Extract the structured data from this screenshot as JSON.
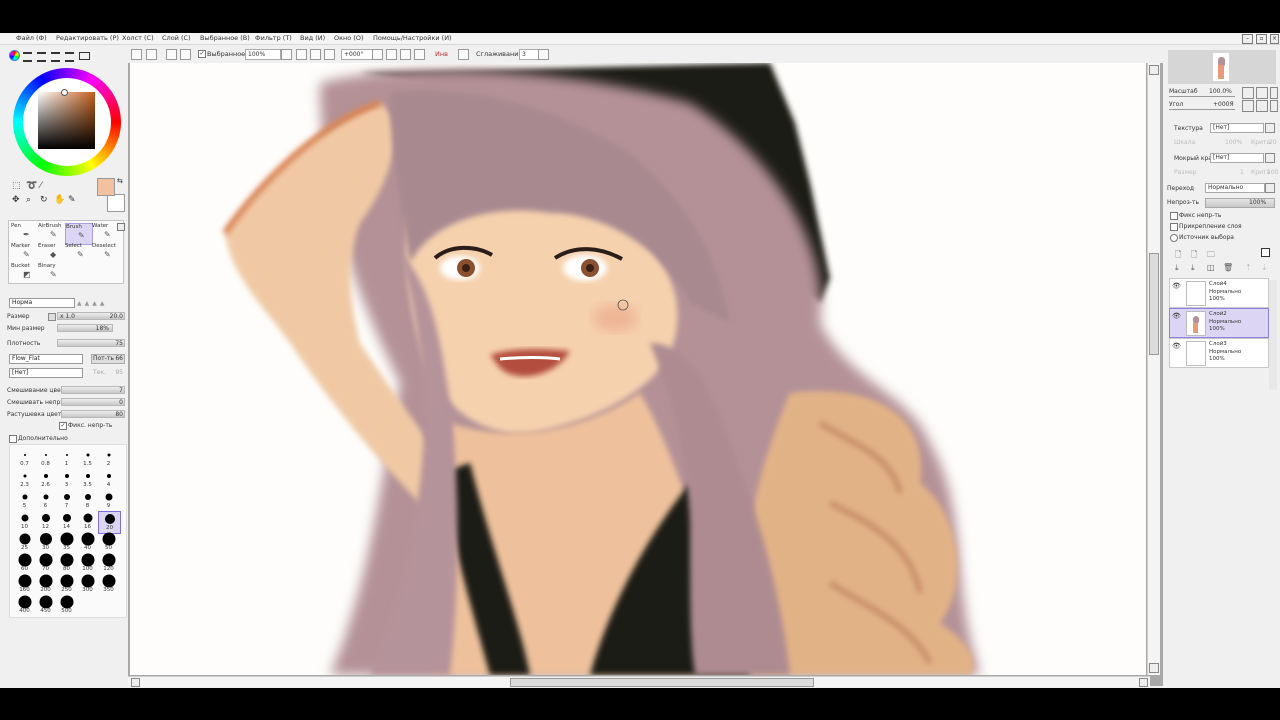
{
  "menu": [
    "Файл (Ф)",
    "Редактировать (Р)",
    "Холст (С)",
    "Слой (С)",
    "Выбранное (В)",
    "Фильтр (Т)",
    "Вид (И)",
    "Окно (О)",
    "Помощь/Настройки (И)"
  ],
  "toolbar": {
    "selection_label": "Выбранное",
    "zoom": "100%",
    "rotation": "+000°",
    "flip_label": "Инв",
    "smoothing_label": "Сглаживание",
    "smoothing_value": "3"
  },
  "color": {
    "foreground": "#f2c2a0",
    "background": "#ffffff"
  },
  "brush_tools": [
    {
      "label": "Pen"
    },
    {
      "label": "AirBrush"
    },
    {
      "label": "Brush"
    },
    {
      "label": "Water"
    },
    {
      "label": "Marker"
    },
    {
      "label": "Eraser"
    },
    {
      "label": "Select"
    },
    {
      "label": "Deselect"
    },
    {
      "label": "Bucket"
    },
    {
      "label": "Binary"
    }
  ],
  "brush_settings": {
    "blend_mode": "Норма",
    "size_label": "Размер",
    "size_mult": "x 1.0",
    "size_value": "20.0",
    "min_size_label": "Мин размер",
    "min_size_value": "18%",
    "density_label": "Плотность",
    "density_value": "75",
    "texture_shape": "Flow_Flat",
    "texture_strength_label": "Пот-ть",
    "texture_strength_value": "66",
    "texture2": "[Нет]",
    "texture2_strength_label": "Тек.",
    "texture2_strength_value": "95",
    "blending_label": "Смешивание цвет",
    "blending_value": "7",
    "dilution_label": "Смешивать непрз",
    "dilution_value": "0",
    "persistence_label": "Растушевка цвет",
    "persistence_value": "80",
    "keep_opacity_label": "Фикс. непр-ть",
    "advanced_label": "Дополнительно"
  },
  "brush_sizes": [
    "0.7",
    "0.8",
    "1",
    "1.5",
    "2",
    "2.3",
    "2.6",
    "3",
    "3.5",
    "4",
    "5",
    "6",
    "7",
    "8",
    "9",
    "10",
    "12",
    "14",
    "16",
    "20",
    "25",
    "30",
    "35",
    "40",
    "50",
    "60",
    "70",
    "80",
    "100",
    "120",
    "160",
    "200",
    "250",
    "300",
    "350",
    "400",
    "450",
    "500"
  ],
  "navigator": {
    "zoom_label": "Масштаб",
    "zoom_value": "100.0%",
    "angle_label": "Угол",
    "angle_value": "+000Я"
  },
  "layer_props": {
    "texture_label": "Текстура",
    "texture_value": "[Нет]",
    "scale_label": "Шкала",
    "scale_value": "100%",
    "strength_label": "Крита",
    "strength_value": "20",
    "wet_label": "Мокрый край",
    "wet_value": "[Нет]",
    "wet_size_label": "Размер",
    "wet_size_value": "1",
    "wet_strength_label": "Крита",
    "wet_strength_value": "100",
    "blend_label": "Переход",
    "blend_value": "Нормально",
    "opacity_label": "Непроз-ть",
    "opacity_value": "100%",
    "fix_opacity": "Фикс непр-ть",
    "clip_label": "Прикрепление слоя",
    "source_label": "Источник выбора"
  },
  "layers": [
    {
      "name": "Слой4",
      "mode": "Нормально",
      "opacity": "100%"
    },
    {
      "name": "Слой2",
      "mode": "Нормально",
      "opacity": "100%"
    },
    {
      "name": "Слой3",
      "mode": "Нормально",
      "opacity": "100%"
    }
  ]
}
